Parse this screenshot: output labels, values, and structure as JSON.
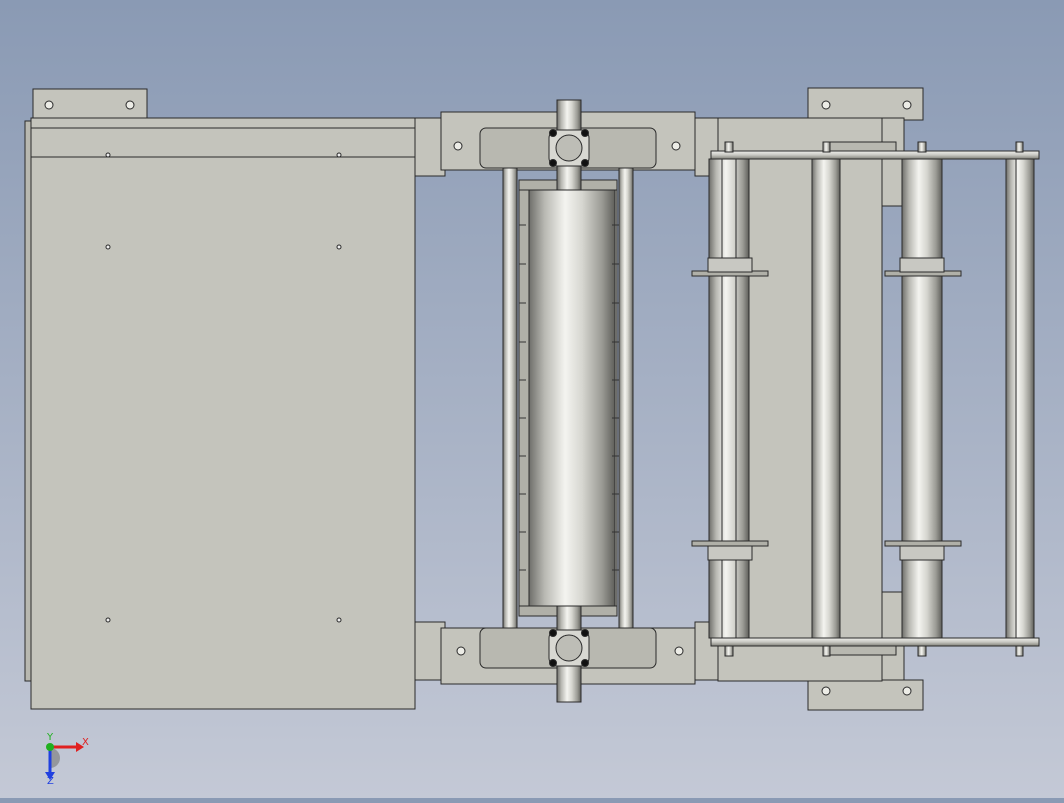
{
  "viewport": {
    "background_top": "#8a9ab4",
    "background_bottom": "#c4c9d6",
    "part_fill": "#c4c4bc",
    "edge_color": "#2a2a2a"
  },
  "triad": {
    "x_label": "X",
    "y_label": "Y",
    "z_label": "Z",
    "x_color": "#e02020",
    "y_color": "#20b020",
    "z_color": "#2040e0"
  }
}
